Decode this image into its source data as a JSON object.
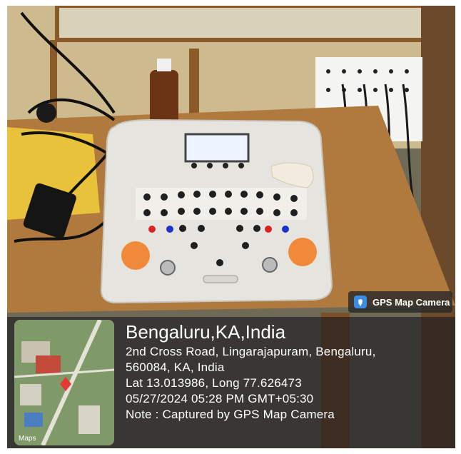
{
  "badge": {
    "label": "GPS Map Camera",
    "icon": "gps-map-camera-icon"
  },
  "location": {
    "city": "Bengaluru,KA,India",
    "address_line1": "2nd Cross Road, Lingarajapuram, Bengaluru,",
    "address_line2": "560084, KA, India",
    "coords": "Lat 13.013986, Long 77.626473",
    "datetime": "05/27/2024 05:28 PM GMT+05:30",
    "note": "Note : Captured by GPS Map Camera"
  },
  "map": {
    "attribution": "Maps"
  },
  "colors": {
    "table": "#b07a3e",
    "device": "#e6e4df",
    "knob": "#f08a3a",
    "wall": "#c8b58a"
  }
}
